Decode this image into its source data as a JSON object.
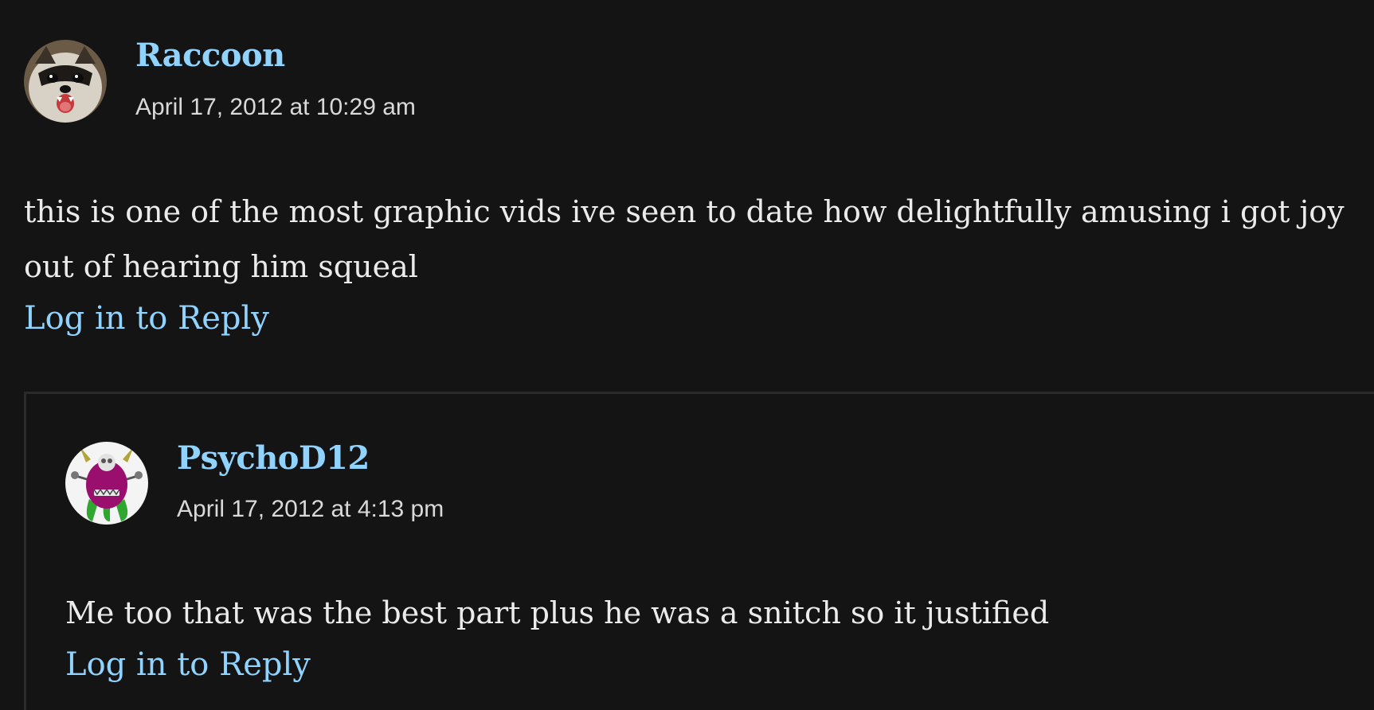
{
  "comments": [
    {
      "author": "Raccoon",
      "date": "April 17, 2012 at 10:29 am",
      "text": "this is one of the most graphic vids ive seen to date how delightfully amusing i got joy out of hearing him squeal",
      "reply_label": "Log in to Reply",
      "avatar_icon": "raccoon-avatar"
    }
  ],
  "replies": [
    {
      "author": "PsychoD12",
      "date": "April 17, 2012 at 4:13 pm",
      "text": "Me too that was the best part plus he was a snitch so it justified",
      "reply_label": "Log in to Reply",
      "avatar_icon": "purple-monster-avatar"
    }
  ],
  "colors": {
    "background": "#141414",
    "link": "#8fd3fe",
    "text": "#ebebeb",
    "date": "#d9d9d9",
    "thread_border": "#2a2a2a"
  }
}
